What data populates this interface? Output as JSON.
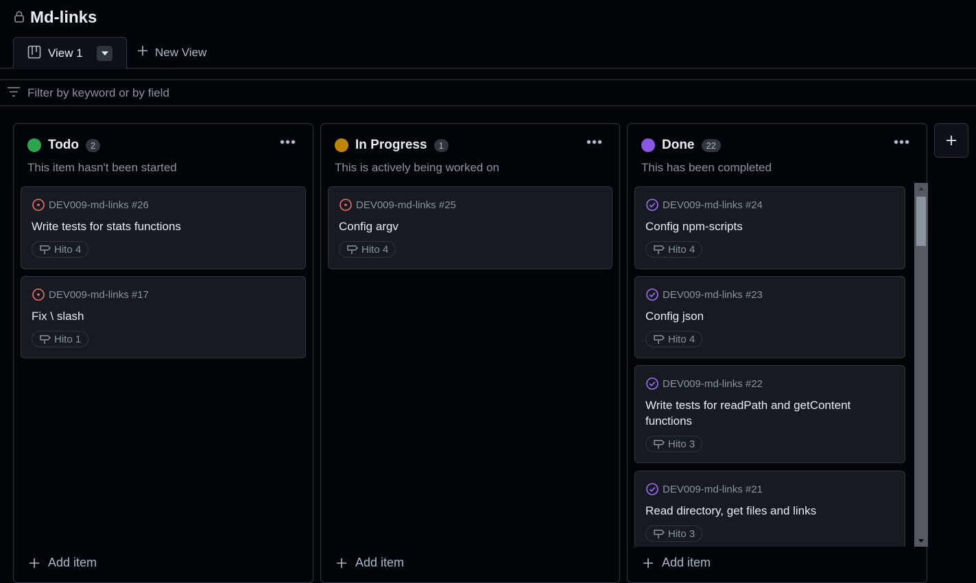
{
  "project": {
    "title": "Md-links"
  },
  "tabs": {
    "view_label": "View 1",
    "new_view_label": "New View"
  },
  "filter": {
    "placeholder": "Filter by keyword or by field"
  },
  "columns": [
    {
      "name": "Todo",
      "count": "2",
      "color": "#2da44e",
      "description": "This item hasn't been started",
      "add_label": "Add item",
      "cards": [
        {
          "ref": "DEV009-md-links #26",
          "title": "Write tests for stats functions",
          "label": "Hito 4",
          "status": "open"
        },
        {
          "ref": "DEV009-md-links #17",
          "title": "Fix \\ slash",
          "label": "Hito 1",
          "status": "open"
        }
      ]
    },
    {
      "name": "In Progress",
      "count": "1",
      "color": "#bf8700",
      "description": "This is actively being worked on",
      "add_label": "Add item",
      "cards": [
        {
          "ref": "DEV009-md-links #25",
          "title": "Config argv",
          "label": "Hito 4",
          "status": "open"
        }
      ]
    },
    {
      "name": "Done",
      "count": "22",
      "color": "#8957e5",
      "description": "This has been completed",
      "add_label": "Add item",
      "cards": [
        {
          "ref": "DEV009-md-links #24",
          "title": "Config npm-scripts",
          "label": "Hito 4",
          "status": "closed"
        },
        {
          "ref": "DEV009-md-links #23",
          "title": "Config json",
          "label": "Hito 4",
          "status": "closed"
        },
        {
          "ref": "DEV009-md-links #22",
          "title": "Write tests for readPath and getContent functions",
          "label": "Hito 3",
          "status": "closed"
        },
        {
          "ref": "DEV009-md-links #21",
          "title": "Read directory, get files and links",
          "label": "Hito 3",
          "status": "closed"
        }
      ]
    }
  ],
  "colors": {
    "open_icon": "#f47067",
    "closed_icon": "#a371f7"
  }
}
